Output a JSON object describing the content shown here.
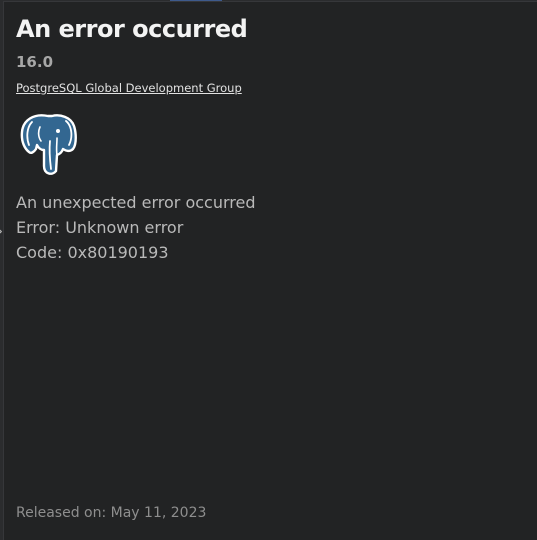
{
  "dialog": {
    "title": "An error occurred",
    "version": "16.0",
    "publisher": "PostgreSQL Global Development Group",
    "logo_icon": "postgresql-elephant-icon",
    "message_lines": [
      "An unexpected error occurred",
      "Error: Unknown error",
      "Code: 0x80190193"
    ],
    "released": "Released on: May 11, 2023"
  },
  "colors": {
    "panel_bg": "#222324",
    "title": "#f3f3f3",
    "muted_text": "#b9b9b9",
    "logo_blue": "#336791"
  }
}
